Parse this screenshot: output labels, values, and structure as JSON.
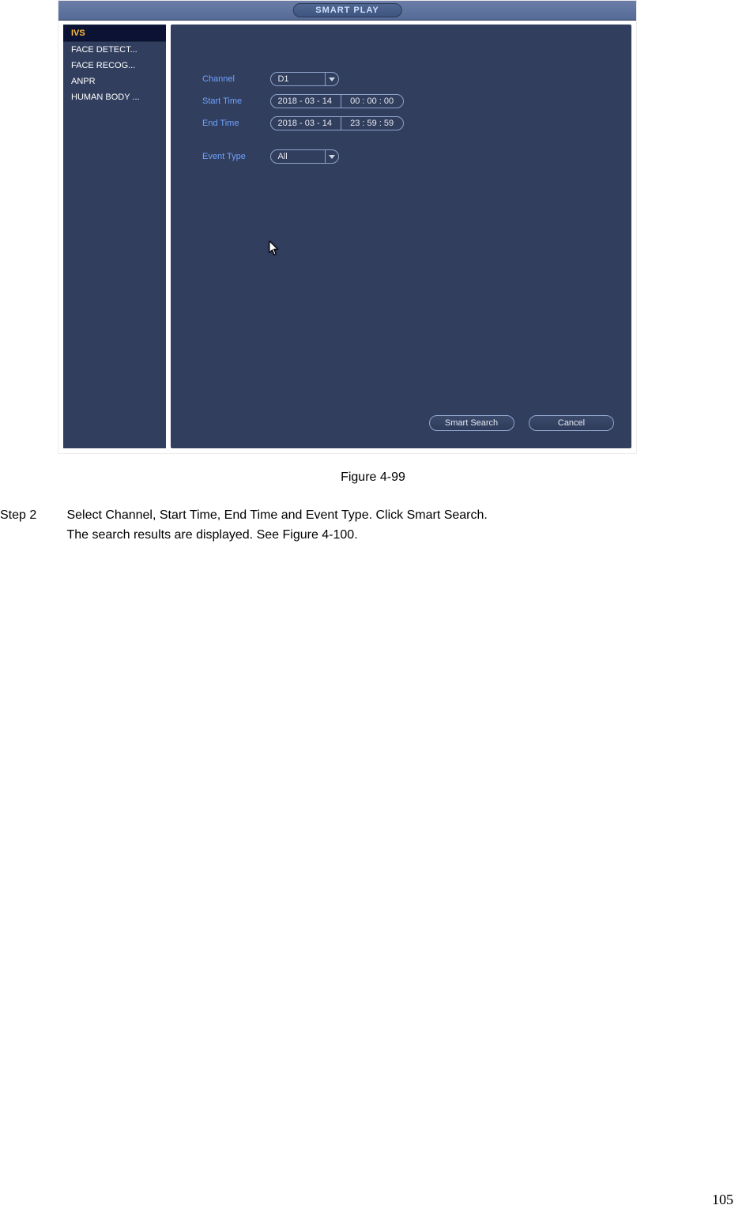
{
  "screenshot": {
    "title": "SMART PLAY",
    "sidebar": {
      "items": [
        {
          "label": "IVS",
          "selected": true
        },
        {
          "label": "FACE DETECT...",
          "selected": false
        },
        {
          "label": "FACE RECOG...",
          "selected": false
        },
        {
          "label": "ANPR",
          "selected": false
        },
        {
          "label": "HUMAN BODY ...",
          "selected": false
        }
      ]
    },
    "form": {
      "channel_label": "Channel",
      "channel_value": "D1",
      "start_label": "Start Time",
      "start_date": "2018  - 03 - 14",
      "start_time": "00 : 00  : 00",
      "end_label": "End Time",
      "end_date": "2018  - 03 - 14",
      "end_time": "23 : 59  : 59",
      "event_label": "Event Type",
      "event_value": "All"
    },
    "buttons": {
      "search": "Smart Search",
      "cancel": "Cancel"
    }
  },
  "caption": "Figure 4-99",
  "step": {
    "label": "Step 2",
    "line1": "Select Channel, Start Time, End Time and Event Type. Click Smart Search.",
    "line2": "The search results are displayed. See Figure 4-100."
  },
  "page_number": "105"
}
